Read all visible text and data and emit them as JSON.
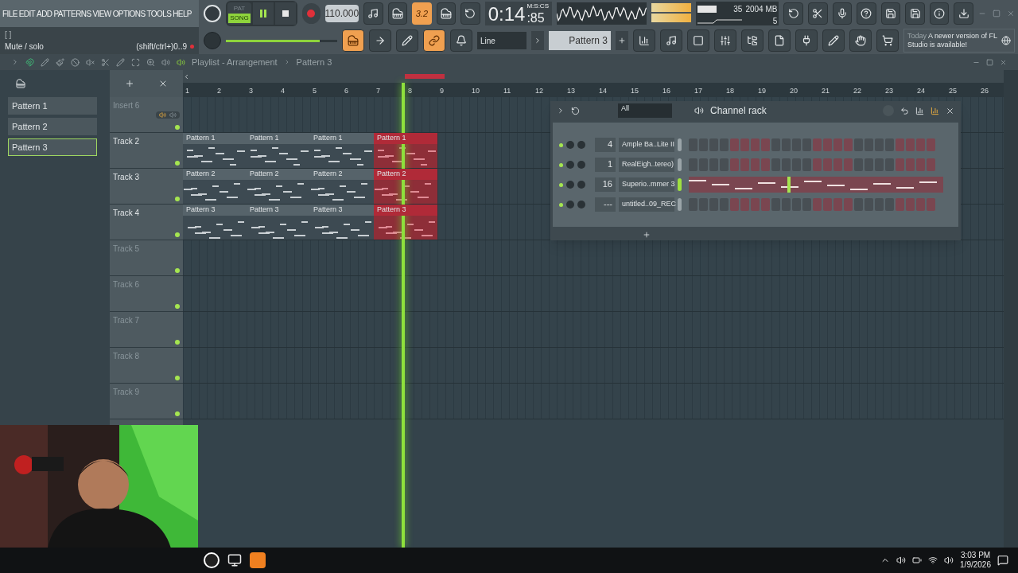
{
  "menu": [
    "FILE",
    "EDIT",
    "ADD",
    "PATTERNS",
    "VIEW",
    "OPTIONS",
    "TOOLS",
    "HELP"
  ],
  "transport": {
    "pat_label": "PAT",
    "song_label": "SONG",
    "song_mode": true,
    "playing": true,
    "tempo": "110.000"
  },
  "time": {
    "value": "0:14",
    "sub": ":85",
    "unit": "M:S:CS"
  },
  "step_toggle": "3.2",
  "cpu": {
    "usage": "35",
    "memory": "2004 MB",
    "polyphony": "5"
  },
  "hint": {
    "brackets": "[  ]",
    "text": "Mute / solo",
    "shortcut": "(shift/ctrl+)0..9"
  },
  "master_volume": {
    "level": 0.84
  },
  "snap": "Line",
  "pattern_selector": "Pattern 3",
  "news": {
    "when": "Today",
    "text": "A newer version of FL Studio is available!"
  },
  "playlist": {
    "title": "Playlist - Arrangement",
    "pattern": "Pattern 3"
  },
  "picker": [
    {
      "name": "Pattern 1",
      "selected": false
    },
    {
      "name": "Pattern 2",
      "selected": false
    },
    {
      "name": "Pattern 3",
      "selected": true
    }
  ],
  "ruler": [
    "1",
    "2",
    "3",
    "4",
    "5",
    "6",
    "7",
    "8",
    "9",
    "10",
    "11",
    "12",
    "13",
    "14",
    "15",
    "16",
    "17",
    "18",
    "19",
    "20",
    "21",
    "22",
    "23",
    "24",
    "25",
    "26"
  ],
  "tracks": [
    {
      "name": "Insert 6",
      "kind": "insert"
    },
    {
      "name": "Track 2",
      "kind": "track",
      "clips": [
        {
          "name": "Pattern 1",
          "selected": false
        },
        {
          "name": "Pattern 1",
          "selected": false
        },
        {
          "name": "Pattern 1",
          "selected": false
        },
        {
          "name": "Pattern 1",
          "selected": true
        }
      ]
    },
    {
      "name": "Track 3",
      "kind": "track",
      "clips": [
        {
          "name": "Pattern 2",
          "selected": false
        },
        {
          "name": "Pattern 2",
          "selected": false
        },
        {
          "name": "Pattern 2",
          "selected": false
        },
        {
          "name": "Pattern 2",
          "selected": true
        }
      ]
    },
    {
      "name": "Track 4",
      "kind": "track",
      "clips": [
        {
          "name": "Pattern 3",
          "selected": false
        },
        {
          "name": "Pattern 3",
          "selected": false
        },
        {
          "name": "Pattern 3",
          "selected": false
        },
        {
          "name": "Pattern 3",
          "selected": true
        }
      ]
    },
    {
      "name": "Track 5",
      "kind": "track"
    },
    {
      "name": "Track 6",
      "kind": "track"
    },
    {
      "name": "Track 7",
      "kind": "track"
    },
    {
      "name": "Track 8",
      "kind": "track"
    },
    {
      "name": "Track 9",
      "kind": "track"
    }
  ],
  "channel_rack": {
    "filter": "All",
    "title": "Channel rack",
    "channels": [
      {
        "number": "4",
        "name": "Ample Ba..Lite II",
        "kind": "steps",
        "selected": false
      },
      {
        "number": "1",
        "name": "RealEigh..tereo)",
        "kind": "steps",
        "selected": false
      },
      {
        "number": "16",
        "name": "Superio..mmer 3",
        "kind": "roll",
        "selected": true
      },
      {
        "number": "---",
        "name": "untitled..09_REC",
        "kind": "steps",
        "selected": false
      }
    ]
  },
  "taskbar": {
    "time": "3:03 PM",
    "date": "1/9/2026"
  }
}
